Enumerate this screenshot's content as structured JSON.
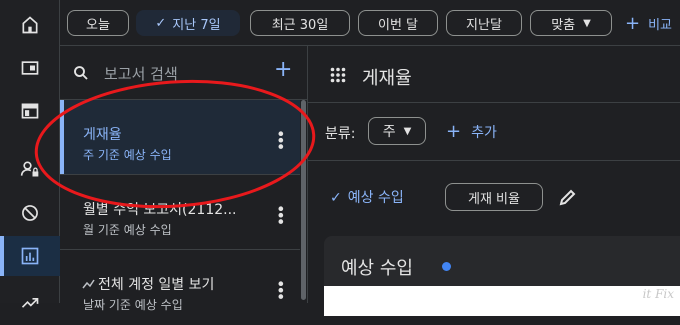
{
  "rail": {
    "items": [
      {
        "icon": "home-icon"
      },
      {
        "icon": "window-icon"
      },
      {
        "icon": "panel-icon"
      },
      {
        "icon": "user-lock-icon"
      },
      {
        "icon": "block-icon"
      },
      {
        "icon": "reports-icon",
        "active": true
      },
      {
        "icon": "trending-icon"
      }
    ]
  },
  "toolbar": {
    "chips": [
      {
        "label": "오늘"
      },
      {
        "label": "지난 7일",
        "selected": true
      },
      {
        "label": "최근 30일"
      },
      {
        "label": "이번 달"
      },
      {
        "label": "지난달"
      },
      {
        "label": "맞춤",
        "dropdown": true
      }
    ],
    "compare_label": "비교"
  },
  "report_list": {
    "search_placeholder": "보고서 검색",
    "items": [
      {
        "title": "게재율",
        "subtitle": "주 기준 예상 수입",
        "active": true
      },
      {
        "title": "월별 수익 보고서(2112...",
        "subtitle": "월 기준 예상 수입"
      },
      {
        "title": "전체 계정 일별 보기",
        "subtitle": "날짜 기준 예상 수입"
      }
    ]
  },
  "main": {
    "title": "게재율",
    "filter_label": "분류:",
    "filter_value": "주",
    "add_label": "추가",
    "selected_metric": "예상 수입",
    "other_metric": "게재 비율",
    "card_title": "예상 수입"
  },
  "colors": {
    "accent": "#8ab4f8",
    "background": "#1f2023",
    "annotation": "#e8191c",
    "series_dot": "#4285f4"
  },
  "watermark": "it Fix"
}
